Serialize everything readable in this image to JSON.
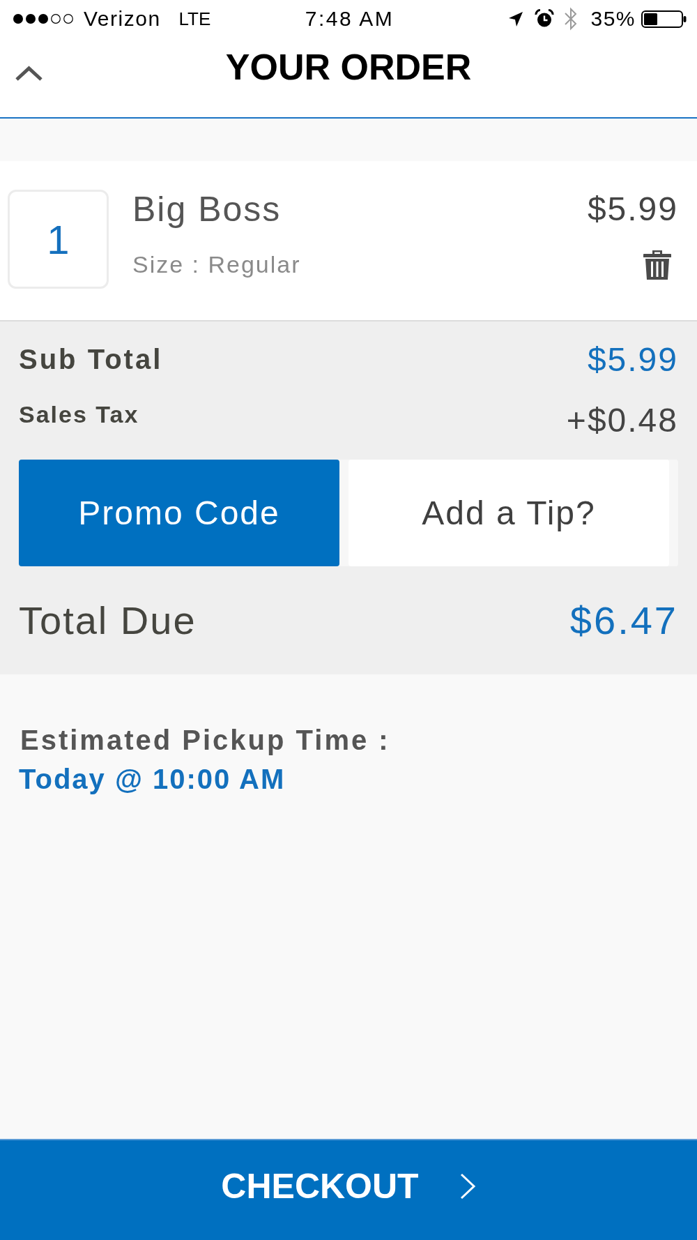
{
  "status_bar": {
    "carrier": "Verizon",
    "network": "LTE",
    "time": "7:48 AM",
    "battery_percent": "35%"
  },
  "header": {
    "title": "YOUR ORDER"
  },
  "items": [
    {
      "quantity": "1",
      "name": "Big Boss",
      "option": "Size : Regular",
      "price": "$5.99"
    }
  ],
  "totals": {
    "rows": [
      {
        "kind": "subtotal",
        "label": "Sub Total",
        "value": "$5.99"
      },
      {
        "kind": "tax",
        "label": "Sales Tax",
        "value": "+$0.48"
      }
    ],
    "options": [
      {
        "label": "Promo Code",
        "selected": true
      },
      {
        "label": "Add a Tip?",
        "selected": false
      }
    ],
    "total": {
      "label": "Total Due",
      "value": "$6.47"
    }
  },
  "pickup": {
    "label": "Estimated Pickup Time :",
    "value": "Today @ 10:00 AM"
  },
  "checkout": {
    "label": "CHECKOUT"
  }
}
